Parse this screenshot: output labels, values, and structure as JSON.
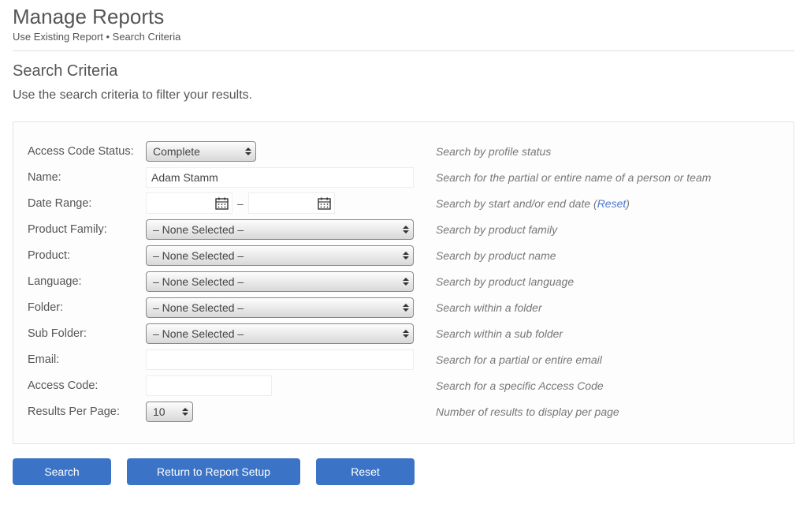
{
  "header": {
    "title": "Manage Reports",
    "breadcrumb": "Use Existing Report • Search Criteria"
  },
  "section": {
    "title": "Search Criteria",
    "description": "Use the search criteria to filter your results."
  },
  "form": {
    "access_code_status": {
      "label": "Access Code Status:",
      "value": "Complete",
      "hint": "Search by profile status"
    },
    "name": {
      "label": "Name:",
      "value": "Adam Stamm",
      "hint": "Search for the partial or entire name of a person or team"
    },
    "date_range": {
      "label": "Date Range:",
      "start": "",
      "end": "",
      "hint_prefix": "Search by start and/or end date  (",
      "reset_link": "Reset",
      "hint_suffix": ")"
    },
    "product_family": {
      "label": "Product Family:",
      "value": "– None Selected –",
      "hint": "Search by product family"
    },
    "product": {
      "label": "Product:",
      "value": "– None Selected –",
      "hint": "Search by product name"
    },
    "language": {
      "label": "Language:",
      "value": "– None Selected –",
      "hint": "Search by product language"
    },
    "folder": {
      "label": "Folder:",
      "value": "– None Selected –",
      "hint": "Search within a folder"
    },
    "sub_folder": {
      "label": "Sub Folder:",
      "value": "– None Selected –",
      "hint": "Search within a sub folder"
    },
    "email": {
      "label": "Email:",
      "value": "",
      "hint": "Search for a partial or entire email"
    },
    "access_code": {
      "label": "Access Code:",
      "value": "",
      "hint": "Search for a specific Access Code"
    },
    "results_per_page": {
      "label": "Results Per Page:",
      "value": "10",
      "hint": "Number of results to display per page"
    }
  },
  "buttons": {
    "search": "Search",
    "return": "Return to Report Setup",
    "reset": "Reset"
  }
}
